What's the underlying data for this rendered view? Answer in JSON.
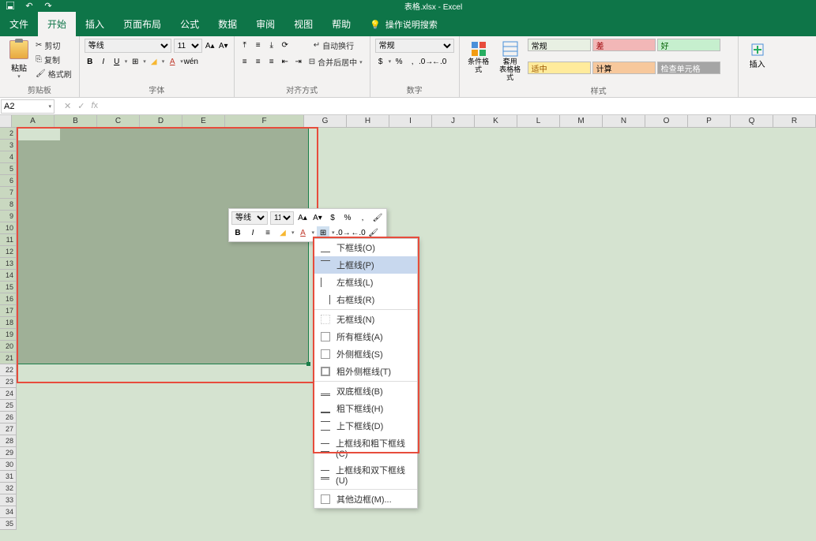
{
  "app": {
    "title_filename": "表格.xlsx",
    "title_app": "Excel"
  },
  "menu": {
    "file": "文件",
    "home": "开始",
    "insert": "插入",
    "page_layout": "页面布局",
    "formulas": "公式",
    "data": "数据",
    "review": "审阅",
    "view": "视图",
    "help": "帮助",
    "search_placeholder": "操作说明搜索"
  },
  "ribbon": {
    "clipboard": {
      "label": "剪贴板",
      "paste": "粘贴",
      "cut": "剪切",
      "copy": "复制",
      "format_painter": "格式刷"
    },
    "font": {
      "label": "字体",
      "family": "等线",
      "size": "11"
    },
    "alignment": {
      "label": "对齐方式",
      "wrap": "自动换行",
      "merge": "合并后居中"
    },
    "number": {
      "label": "数字",
      "format": "常规"
    },
    "styles": {
      "label": "样式",
      "conditional": "条件格式",
      "table": "套用\n表格格式",
      "normal": "常规",
      "bad": "差",
      "good": "好",
      "neutral": "适中",
      "calculation": "计算",
      "check": "检查单元格"
    },
    "insert_label": "插入"
  },
  "name_box": "A2",
  "columns": [
    "A",
    "B",
    "C",
    "D",
    "E",
    "F",
    "G",
    "H",
    "I",
    "J",
    "K",
    "L",
    "M",
    "N",
    "O",
    "P",
    "Q",
    "R"
  ],
  "rows_selected_end": 21,
  "rows_total": 35,
  "mini_toolbar": {
    "font": "等线",
    "size": "11"
  },
  "border_menu": {
    "bottom": "下框线(O)",
    "top": "上框线(P)",
    "left": "左框线(L)",
    "right": "右框线(R)",
    "none": "无框线(N)",
    "all": "所有框线(A)",
    "outside": "外侧框线(S)",
    "thick_outside": "粗外侧框线(T)",
    "double_bottom": "双底框线(B)",
    "thick_bottom": "粗下框线(H)",
    "top_bottom": "上下框线(D)",
    "top_thick_bottom": "上框线和粗下框线(C)",
    "top_double_bottom": "上框线和双下框线(U)",
    "more": "其他边框(M)..."
  }
}
